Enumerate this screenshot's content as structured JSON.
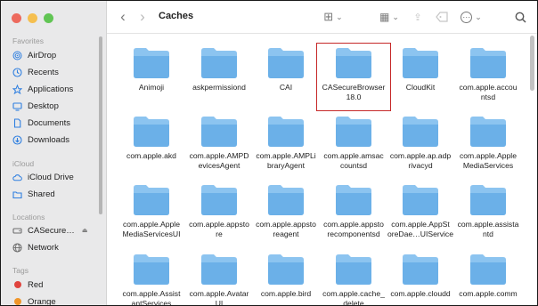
{
  "window": {
    "title": "Caches"
  },
  "sidebar": {
    "favorites_label": "Favorites",
    "favorites": [
      {
        "label": "AirDrop",
        "icon": "airdrop-icon"
      },
      {
        "label": "Recents",
        "icon": "clock-icon"
      },
      {
        "label": "Applications",
        "icon": "applications-icon"
      },
      {
        "label": "Desktop",
        "icon": "desktop-icon"
      },
      {
        "label": "Documents",
        "icon": "document-icon"
      },
      {
        "label": "Downloads",
        "icon": "download-icon"
      }
    ],
    "icloud_label": "iCloud",
    "icloud": [
      {
        "label": "iCloud Drive",
        "icon": "cloud-icon"
      },
      {
        "label": "Shared",
        "icon": "shared-folder-icon"
      }
    ],
    "locations_label": "Locations",
    "locations": [
      {
        "label": "CASecure…",
        "icon": "disk-icon",
        "eject": "⏏"
      },
      {
        "label": "Network",
        "icon": "globe-icon"
      }
    ],
    "tags_label": "Tags",
    "tags": [
      {
        "label": "Red",
        "color": "#e0443e"
      },
      {
        "label": "Orange",
        "color": "#f0962a"
      }
    ]
  },
  "toolbar": {
    "back_icon": "‹",
    "forward_icon": "›",
    "view_icon": "⊞",
    "chevron": "⌄",
    "group_icon": "▦",
    "share_icon": "⇪",
    "tag_icon": "⌂",
    "more_icon": "⋯",
    "search_icon": "⌕"
  },
  "colors": {
    "folder": "#6bb0e8",
    "folder_top": "#8cc4f0",
    "selection": "#c62828"
  },
  "files": [
    "Animoji",
    "askpermissiond",
    "CAI",
    "CASecureBrowser18.0",
    "CloudKit",
    "com.apple.accountsd",
    "com.apple.akd",
    "com.apple.AMPDevicesAgent",
    "com.apple.AMPLibraryAgent",
    "com.apple.amsaccountsd",
    "com.apple.ap.adprivacyd",
    "com.apple.AppleMediaServices",
    "com.apple.AppleMediaServicesUI",
    "com.apple.appstore",
    "com.apple.appstoreagent",
    "com.apple.appstorecomponentsd",
    "com.apple.AppStoreDae…UIService",
    "com.apple.assistantd",
    "com.apple.AssistantServices",
    "com.apple.AvatarUI",
    "com.apple.bird",
    "com.apple.cache_delete",
    "com.apple.cloudd",
    "com.apple.comm"
  ],
  "file_labels": [
    [
      "Animoji"
    ],
    [
      "askpermissiond"
    ],
    [
      "CAI"
    ],
    [
      "CASecureBrowser",
      "18.0"
    ],
    [
      "CloudKit"
    ],
    [
      "com.apple.accou",
      "ntsd"
    ],
    [
      "com.apple.akd"
    ],
    [
      "com.apple.AMPD",
      "evicesAgent"
    ],
    [
      "com.apple.AMPLi",
      "braryAgent"
    ],
    [
      "com.apple.amsac",
      "countsd"
    ],
    [
      "com.apple.ap.adp",
      "rivacyd"
    ],
    [
      "com.apple.Apple",
      "MediaServices"
    ],
    [
      "com.apple.Apple",
      "MediaServicesUI"
    ],
    [
      "com.apple.appsto",
      "re"
    ],
    [
      "com.apple.appsto",
      "reagent"
    ],
    [
      "com.apple.appsto",
      "recomponentsd"
    ],
    [
      "com.apple.AppSt",
      "oreDae…UIService"
    ],
    [
      "com.apple.assista",
      "ntd"
    ],
    [
      "com.apple.Assist",
      "antServices"
    ],
    [
      "com.apple.Avatar",
      "UI"
    ],
    [
      "com.apple.bird"
    ],
    [
      "com.apple.cache_",
      "delete"
    ],
    [
      "com.apple.cloudd"
    ],
    [
      "com.apple.comm"
    ]
  ],
  "selected_file": "CASecureBrowser18.0"
}
